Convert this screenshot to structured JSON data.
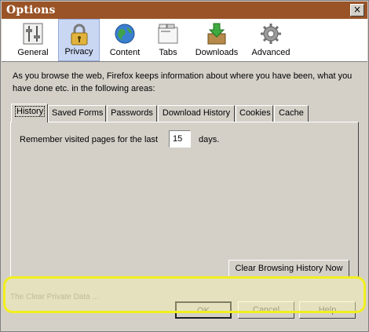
{
  "window": {
    "title": "Options",
    "close_glyph": "×"
  },
  "toolbar": {
    "items": [
      {
        "label": "General",
        "icon": "sliders-icon"
      },
      {
        "label": "Privacy",
        "icon": "padlock-icon",
        "selected": true
      },
      {
        "label": "Content",
        "icon": "globe-icon"
      },
      {
        "label": "Tabs",
        "icon": "tabs-window-icon"
      },
      {
        "label": "Downloads",
        "icon": "download-box-icon"
      },
      {
        "label": "Advanced",
        "icon": "gear-icon"
      }
    ]
  },
  "description": "As you browse the web, Firefox keeps information about where you have been, what you have done etc. in the following areas:",
  "tabs": [
    {
      "label": "History",
      "active": true
    },
    {
      "label": "Saved Forms"
    },
    {
      "label": "Passwords"
    },
    {
      "label": "Download History"
    },
    {
      "label": "Cookies"
    },
    {
      "label": "Cache"
    }
  ],
  "history": {
    "label_prefix": "Remember visited pages for the last",
    "days_value": "15",
    "days_suffix": "days."
  },
  "clear_button": "Clear Browsing History Now",
  "footer": {
    "partial_text": "The Clear Private Data ...",
    "ok": "OK",
    "cancel": "Cancel",
    "help": "Help"
  },
  "colors": {
    "title_bar": "#9a5326",
    "highlight": "#f2ef1e",
    "dialog_bg": "#d4d0c8"
  }
}
